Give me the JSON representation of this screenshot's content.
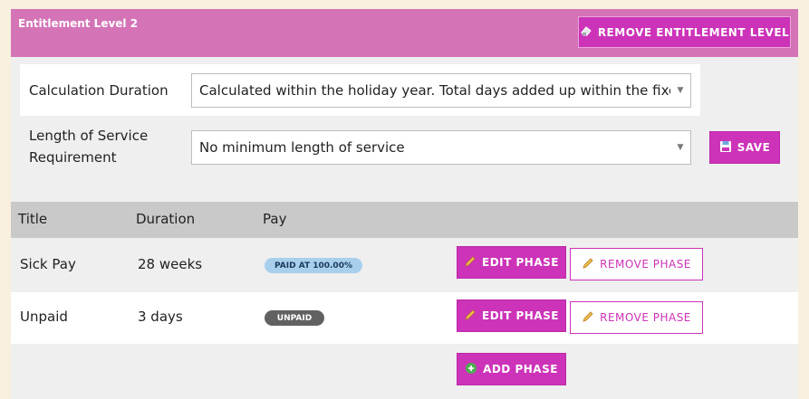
{
  "header": {
    "title": "Entitlement Level 2",
    "remove_level_label": "REMOVE ENTITLEMENT LEVEL"
  },
  "calculation": {
    "label": "Calculation Duration",
    "value": "Calculated within the holiday year. Total days added up within the fixed period."
  },
  "service": {
    "label_line1": "Length of Service",
    "label_line2": "Requirement",
    "value": "No minimum length of service",
    "save_label": "SAVE"
  },
  "table": {
    "headers": [
      "Title",
      "Duration",
      "Pay"
    ],
    "rows": [
      {
        "title": "Sick Pay",
        "duration": "28 weeks",
        "pay": "PAID AT 100.00%",
        "edit_label": "EDIT PHASE",
        "remove_label": "REMOVE PHASE"
      },
      {
        "title": "Unpaid",
        "duration": "3 days",
        "pay": "UNPAID",
        "edit_label": "EDIT PHASE",
        "remove_label": "REMOVE PHASE"
      }
    ],
    "add_label": "ADD PHASE"
  },
  "colors": {
    "accent": "#cc33b8",
    "header": "#d474b7",
    "paid_badge": "#a8d0ec",
    "unpaid_badge": "#616161"
  }
}
